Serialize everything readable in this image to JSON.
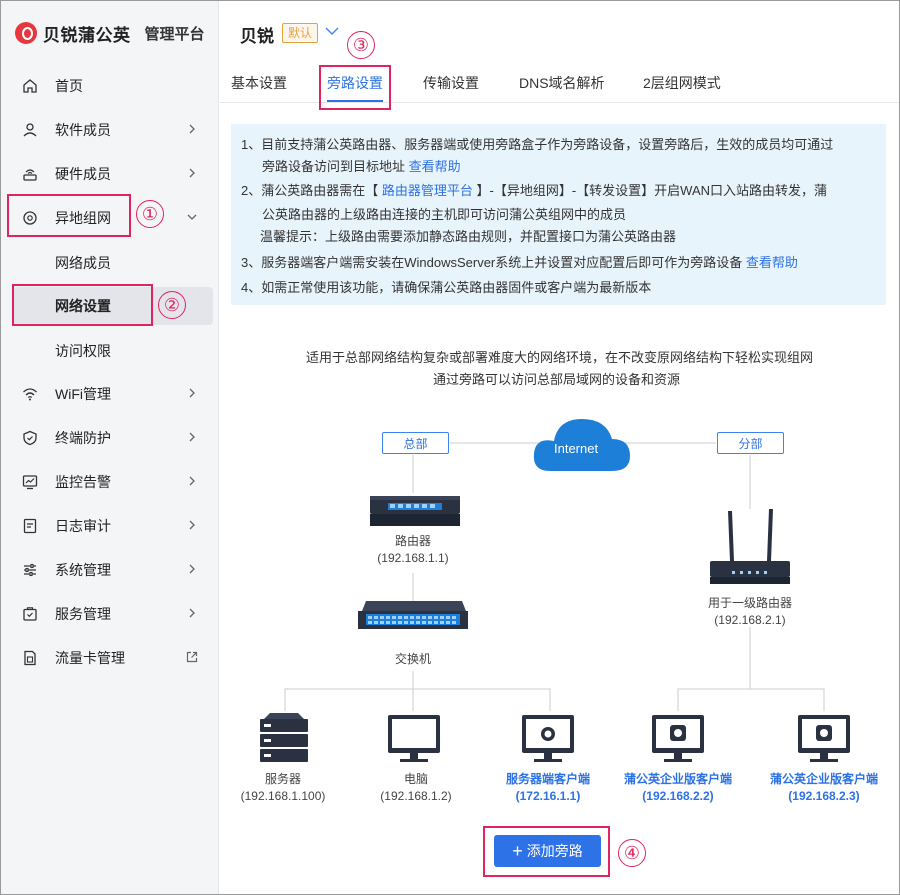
{
  "brand": {
    "name": "贝锐蒲公英",
    "subtitle": "管理平台"
  },
  "sidebar": {
    "items": [
      {
        "label": "首页"
      },
      {
        "label": "软件成员"
      },
      {
        "label": "硬件成员"
      },
      {
        "label": "异地组网"
      },
      {
        "label": "WiFi管理"
      },
      {
        "label": "终端防护"
      },
      {
        "label": "监控告警"
      },
      {
        "label": "日志审计"
      },
      {
        "label": "系统管理"
      },
      {
        "label": "服务管理"
      },
      {
        "label": "流量卡管理"
      }
    ],
    "sub_items": [
      {
        "label": "网络成员"
      },
      {
        "label": "网络设置"
      },
      {
        "label": "访问权限"
      }
    ]
  },
  "annotations": [
    "①",
    "②",
    "③",
    "④"
  ],
  "device": {
    "name": "贝锐",
    "badge": "默认"
  },
  "tabs": [
    {
      "label": "基本设置"
    },
    {
      "label": "旁路设置"
    },
    {
      "label": "传输设置"
    },
    {
      "label": "DNS域名解析"
    },
    {
      "label": "2层组网模式"
    }
  ],
  "info": {
    "line1": "1、目前支持蒲公英路由器、服务器端或使用旁路盒子作为旁路设备，设置旁路后，生效的成员均可通过",
    "line2": "旁路设备访问到目标地址",
    "line2_link": "查看帮助",
    "line3_a": "2、蒲公英路由器需在【",
    "line3_link": "路由器管理平台",
    "line3_b": "】-【异地组网】-【转发设置】开启WAN口入站路由转发，蒲",
    "line4": "公英路由器的上级路由连接的主机即可访问蒲公英组网中的成员",
    "line5": "温馨提示：上级路由需要添加静态路由规则，并配置接口为蒲公英路由器",
    "line6": "3、服务器端客户端需安装在WindowsServer系统上并设置对应配置后即可作为旁路设备",
    "line6_link": "查看帮助",
    "line7": "4、如需正常使用该功能，请确保蒲公英路由器固件或客户端为最新版本"
  },
  "diagram": {
    "caption1": "适用于总部网络结构复杂或部署难度大的网络环境，在不改变原网络结构下轻松实现组网",
    "caption2": "通过旁路可以访问总部局域网的设备和资源",
    "cloud": "Internet",
    "hq": "总部",
    "branch": "分部",
    "router_name": "路由器",
    "router_ip": "(192.168.1.1)",
    "switch_name": "交换机",
    "branch_router_name": "用于一级路由器",
    "branch_router_ip": "(192.168.2.1)",
    "server_name": "服务器",
    "server_ip": "(192.168.1.100)",
    "pc_name": "电脑",
    "pc_ip": "(192.168.1.2)",
    "client1_name": "服务器端客户端",
    "client1_ip": "(172.16.1.1)",
    "client2_name": "蒲公英企业版客户端",
    "client2_ip": "(192.168.2.2)",
    "client3_name": "蒲公英企业版客户端",
    "client3_ip": "(192.168.2.3)"
  },
  "add_button": {
    "icon": "+",
    "label": "添加旁路"
  },
  "colors": {
    "accent": "#2d72e6",
    "annotation": "#e0245e",
    "badge": "#e6a23c",
    "info_bg": "#e8f4fb",
    "cloud": "#1e7fd8"
  }
}
